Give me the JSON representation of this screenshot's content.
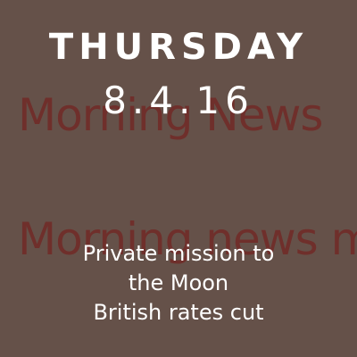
{
  "watermark": {
    "line1": "Morning News",
    "line2": "Morning news m"
  },
  "header": {
    "day": "THURSDAY",
    "date": "8.4.16"
  },
  "headlines": [
    "Private mission to",
    "the Moon",
    "British rates cut"
  ],
  "colors": {
    "background": "#655149",
    "watermark": "#6f2f2b",
    "text": "#ffffff"
  }
}
